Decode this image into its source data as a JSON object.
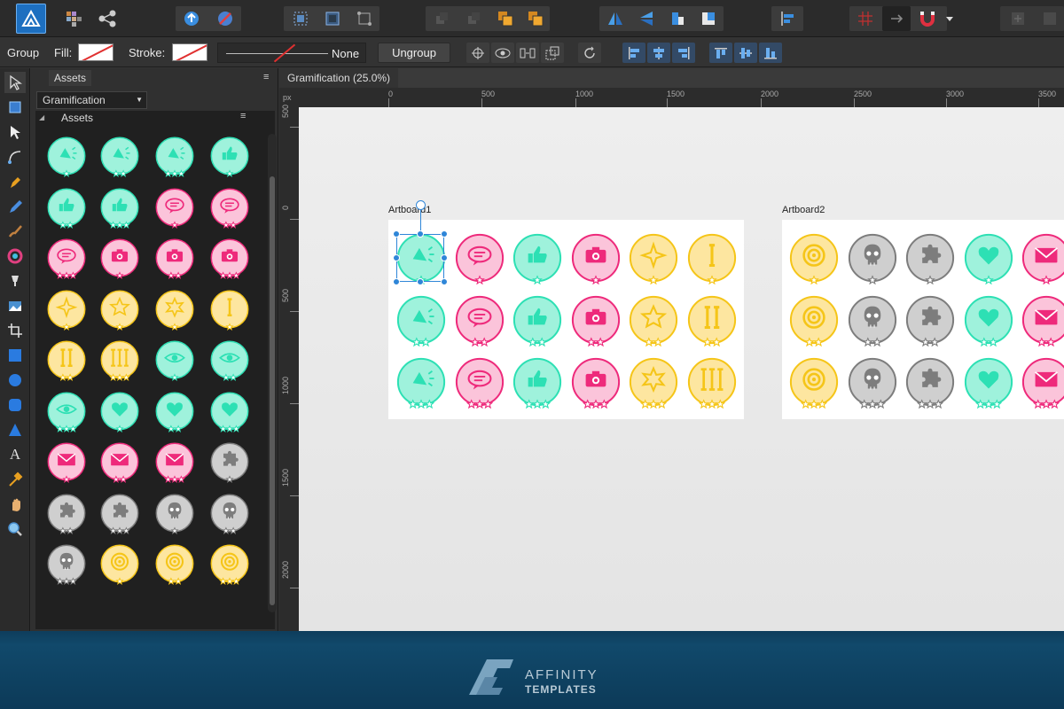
{
  "context_bar": {
    "group_label": "Group",
    "fill_label": "Fill:",
    "stroke_label": "Stroke:",
    "stroke_style": "None",
    "ungroup_label": "Ungroup"
  },
  "panel": {
    "tab_label": "Assets",
    "dropdown_value": "Gramification",
    "section_title": "Assets"
  },
  "document": {
    "tab_title": "Gramification (25.0%)",
    "ruler_unit": "px",
    "h_ticks": [
      "0",
      "500",
      "1000",
      "1500",
      "2000",
      "2500",
      "3000",
      "3500"
    ],
    "v_ticks": [
      "500",
      "0",
      "500",
      "1000",
      "1500",
      "2000"
    ],
    "artboard1_label": "Artboard1",
    "artboard2_label": "Artboard2"
  },
  "brand": {
    "line1": "AFFINITY",
    "line2": "TEMPLATES"
  },
  "colors": {
    "teal": "#2de0b4",
    "pink": "#ee2a7b",
    "yellow": "#f5c518",
    "gray": "#7d7d7d",
    "accent": "#2f86d8"
  },
  "asset_grid": [
    [
      "teal:megaphone:1",
      "teal:megaphone:2",
      "teal:megaphone:3",
      "teal:thumb:1"
    ],
    [
      "teal:thumb:2",
      "teal:thumb:3",
      "pink:chat:1",
      "pink:chat:2"
    ],
    [
      "pink:chat:3",
      "pink:camera:1",
      "pink:camera:2",
      "pink:camera:3"
    ],
    [
      "yellow:star4:1",
      "yellow:star5:1",
      "yellow:star6:1",
      "yellow:roman1:1"
    ],
    [
      "yellow:roman2:2",
      "yellow:roman3:3",
      "teal:eye:1",
      "teal:eye:2"
    ],
    [
      "teal:eye:3",
      "teal:heart:1",
      "teal:heart:2",
      "teal:heart:3"
    ],
    [
      "pink:mail:1",
      "pink:mail:2",
      "pink:mail:3",
      "gray:puzzle:1"
    ],
    [
      "gray:puzzle:2",
      "gray:puzzle:3",
      "gray:skull:1",
      "gray:skull:2"
    ],
    [
      "gray:skull:3",
      "yellow:target:1",
      "yellow:target:2",
      "yellow:target:3"
    ]
  ],
  "artboard1_grid": [
    [
      "teal:megaphone:1",
      "pink:chat:1",
      "teal:thumb:1",
      "pink:camera:1",
      "yellow:star4:1",
      "yellow:roman1:1"
    ],
    [
      "teal:megaphone:2",
      "pink:chat:2",
      "teal:thumb:2",
      "pink:camera:2",
      "yellow:star5:2",
      "yellow:roman2:2"
    ],
    [
      "teal:megaphone:3",
      "pink:chat:3",
      "teal:thumb:3",
      "pink:camera:3",
      "yellow:star6:3",
      "yellow:roman3:3"
    ]
  ],
  "artboard2_grid": [
    [
      "yellow:target:1",
      "gray:skull:1",
      "gray:puzzle:1",
      "teal:heart:1",
      "pink:mail:1"
    ],
    [
      "yellow:target:2",
      "gray:skull:2",
      "gray:puzzle:2",
      "teal:heart:2",
      "pink:mail:2"
    ],
    [
      "yellow:target:3",
      "gray:skull:3",
      "gray:puzzle:3",
      "teal:heart:3",
      "pink:mail:3"
    ]
  ]
}
